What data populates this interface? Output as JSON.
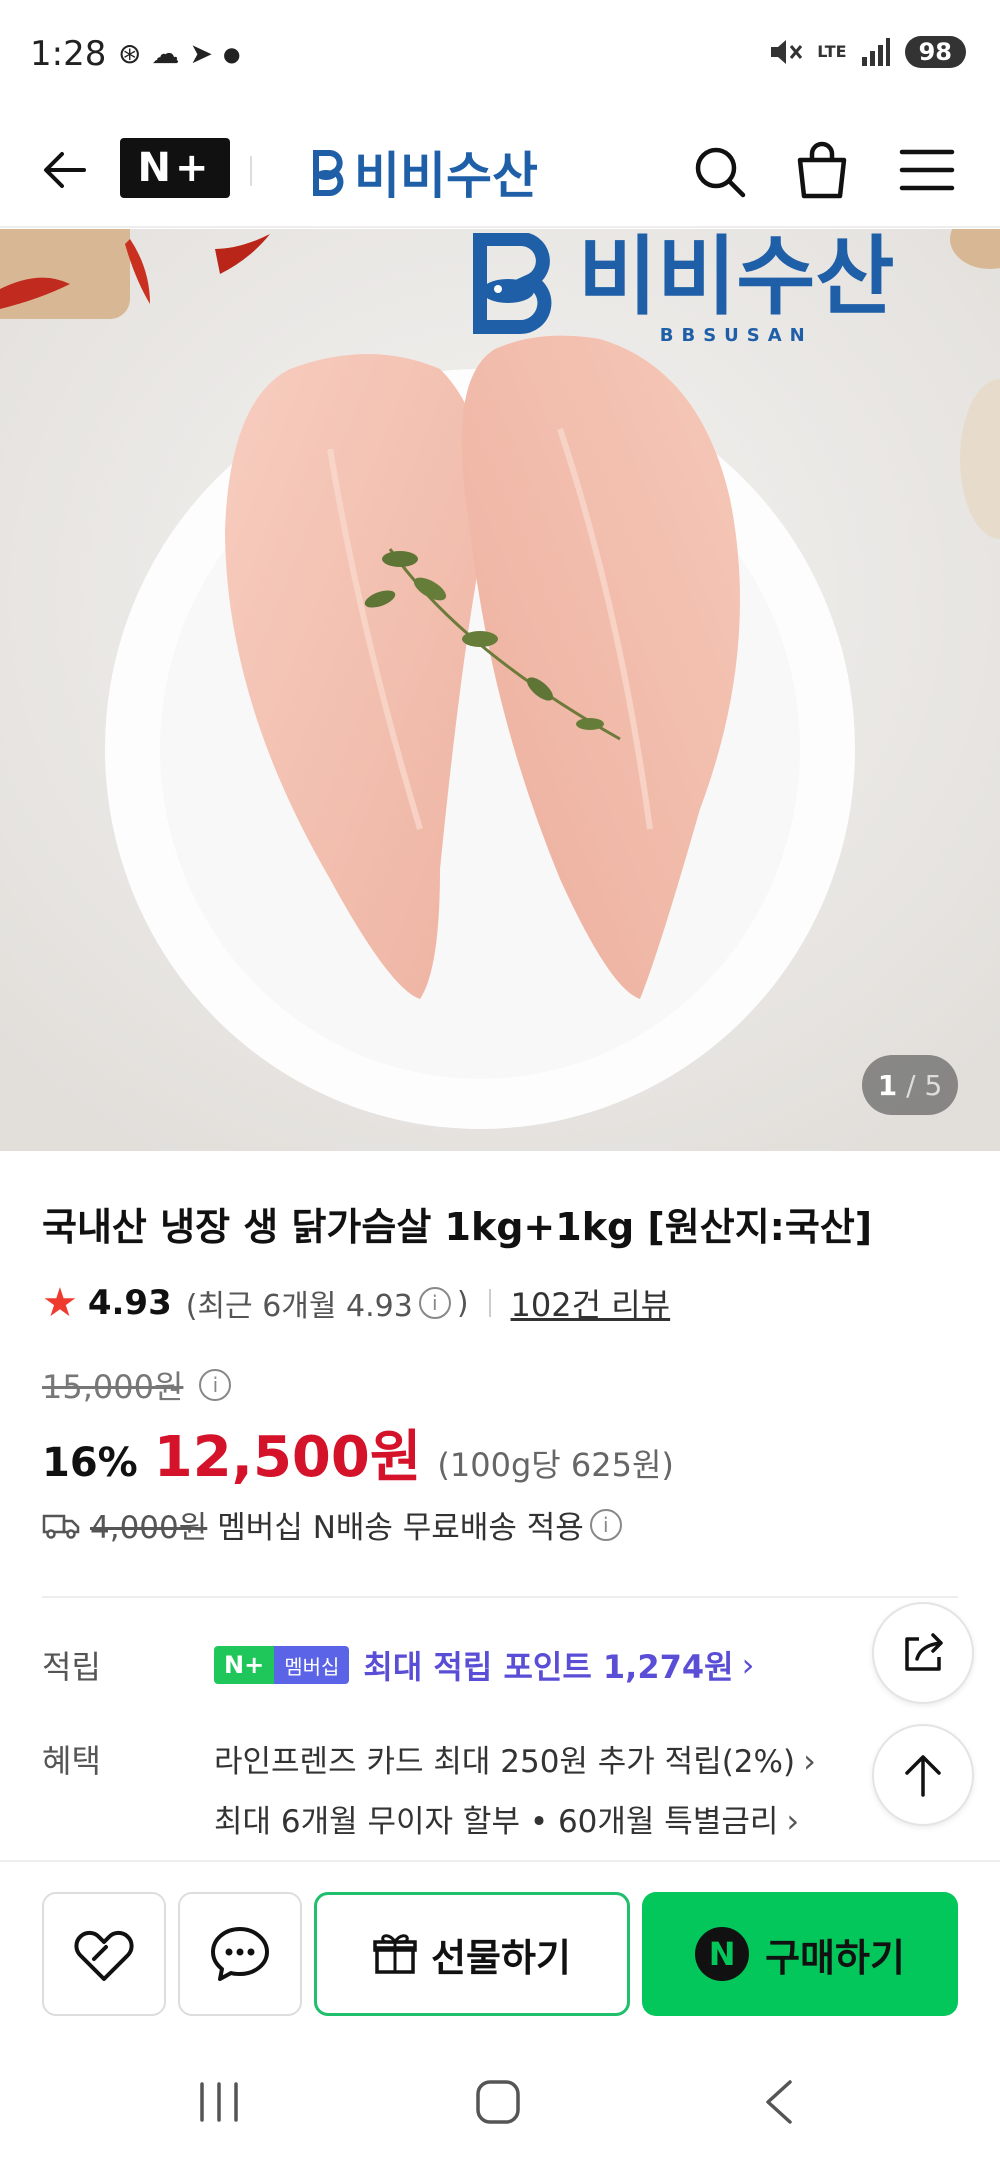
{
  "status": {
    "time": "1:28",
    "battery": "98",
    "network": "LTE"
  },
  "header": {
    "brand": "비비수산",
    "nplus": "N+"
  },
  "image": {
    "brand_text": "비비수산",
    "brand_sub": "BBSUSAN",
    "counter_current": "1",
    "counter_total": "/ 5"
  },
  "product": {
    "title": "국내산 냉장 생 닭가슴살 1kg+1kg [원산지:국산]",
    "rating": "4.93",
    "rating_recent_prefix": "(최근 6개월 4.93",
    "rating_recent_suffix": ")",
    "review_count": "102건 리뷰",
    "original_price": "15,000원",
    "discount": "16%",
    "sale_price": "12,500원",
    "unit_price": "(100g당 625원)",
    "shipping_original": "4,000원",
    "shipping_text": "멤버십 N배송 무료배송 적용"
  },
  "points": {
    "label": "적립",
    "badge_n": "N+",
    "badge_member": "멤버십",
    "text": "최대 적립 포인트 1,274원"
  },
  "benefits": {
    "label": "혜택",
    "items": [
      "라인프렌즈 카드 최대 250원 추가 적립(2%)",
      "최대 6개월 무이자 할부 • 60개월 특별금리"
    ]
  },
  "actions": {
    "gift_label": "선물하기",
    "buy_label": "구매하기",
    "buy_badge": "N"
  },
  "colors": {
    "brand_blue": "#1f5fa7",
    "sale_red": "#d4122a",
    "naver_green": "#03c75a",
    "points_purple": "#5b4ed6"
  }
}
